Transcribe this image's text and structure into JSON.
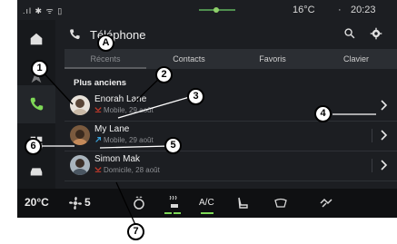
{
  "status": {
    "temperature": "16°C",
    "separator": "·",
    "time": "20:23"
  },
  "header": {
    "title": "Téléphone"
  },
  "tabs": [
    {
      "label": "Récents",
      "active": true
    },
    {
      "label": "Contacts",
      "active": false
    },
    {
      "label": "Favoris",
      "active": false
    },
    {
      "label": "Clavier",
      "active": false
    }
  ],
  "section_title": "Plus anciens",
  "calls": [
    {
      "name": "Enorah Lane",
      "detail": "Mobile, 29 août",
      "call_icon": "missed-call-icon",
      "call_icon_color": "#c0392b"
    },
    {
      "name": "My Lane",
      "detail": "Mobile, 29 août",
      "call_icon": "outgoing-call-icon",
      "call_icon_color": "#3aa0d8"
    },
    {
      "name": "Simon Mak",
      "detail": "Domicile, 28 août",
      "call_icon": "missed-call-icon",
      "call_icon_color": "#c0392b"
    }
  ],
  "climate": {
    "temp_left": "20°C",
    "fan_level": "5",
    "ac_label": "A/C"
  },
  "callouts": [
    "A",
    "1",
    "2",
    "3",
    "4",
    "5",
    "6",
    "7"
  ],
  "colors": {
    "accent": "#7ed957",
    "background": "#1c1e22"
  }
}
